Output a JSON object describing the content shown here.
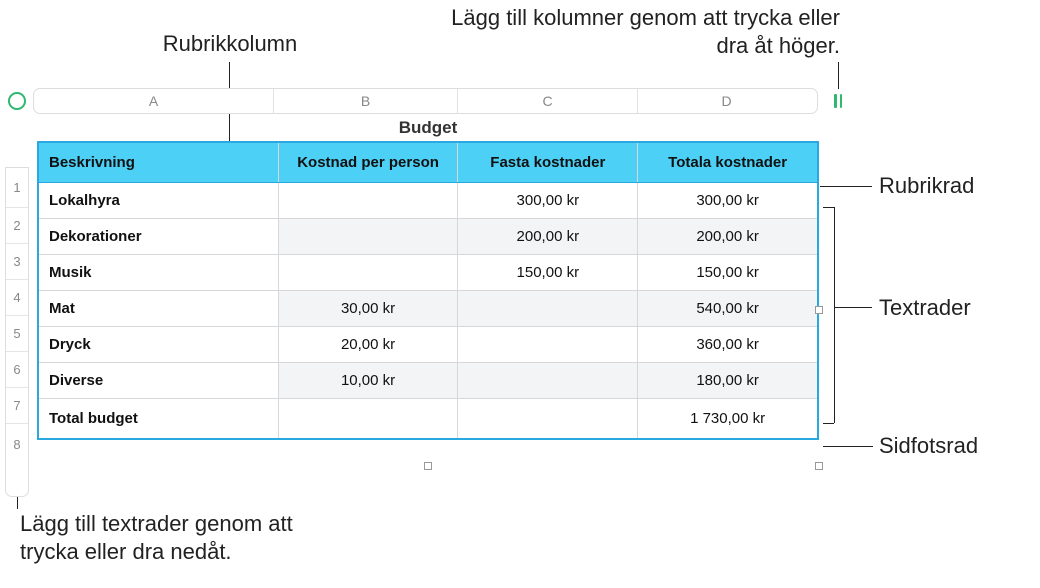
{
  "callouts": {
    "rubrikkolumn": "Rubrikkolumn",
    "add_columns_instruction": "Lägg till kolumner genom att trycka eller dra åt höger.",
    "rubrikrad": "Rubrikrad",
    "textrader": "Textrader",
    "sidfotsrad": "Sidfotsrad",
    "add_rows_instruction": "Lägg till textrader genom att trycka eller dra nedåt."
  },
  "ruler": {
    "columns": [
      "A",
      "B",
      "C",
      "D"
    ],
    "rows": [
      "1",
      "2",
      "3",
      "4",
      "5",
      "6",
      "7",
      "8"
    ]
  },
  "table": {
    "title": "Budget",
    "header": {
      "c0": "Beskrivning",
      "c1": "Kostnad per person",
      "c2": "Fasta kostnader",
      "c3": "Totala kostnader"
    },
    "rows": [
      {
        "c0": "Lokalhyra",
        "c1": "",
        "c2": "300,00 kr",
        "c3": "300,00 kr"
      },
      {
        "c0": "Dekorationer",
        "c1": "",
        "c2": "200,00 kr",
        "c3": "200,00 kr"
      },
      {
        "c0": "Musik",
        "c1": "",
        "c2": "150,00 kr",
        "c3": "150,00 kr"
      },
      {
        "c0": "Mat",
        "c1": "30,00 kr",
        "c2": "",
        "c3": "540,00 kr"
      },
      {
        "c0": "Dryck",
        "c1": "20,00 kr",
        "c2": "",
        "c3": "360,00 kr"
      },
      {
        "c0": "Diverse",
        "c1": "10,00 kr",
        "c2": "",
        "c3": "180,00 kr"
      }
    ],
    "footer": {
      "c0": "Total budget",
      "c1": "",
      "c2": "",
      "c3": "1 730,00 kr"
    }
  }
}
